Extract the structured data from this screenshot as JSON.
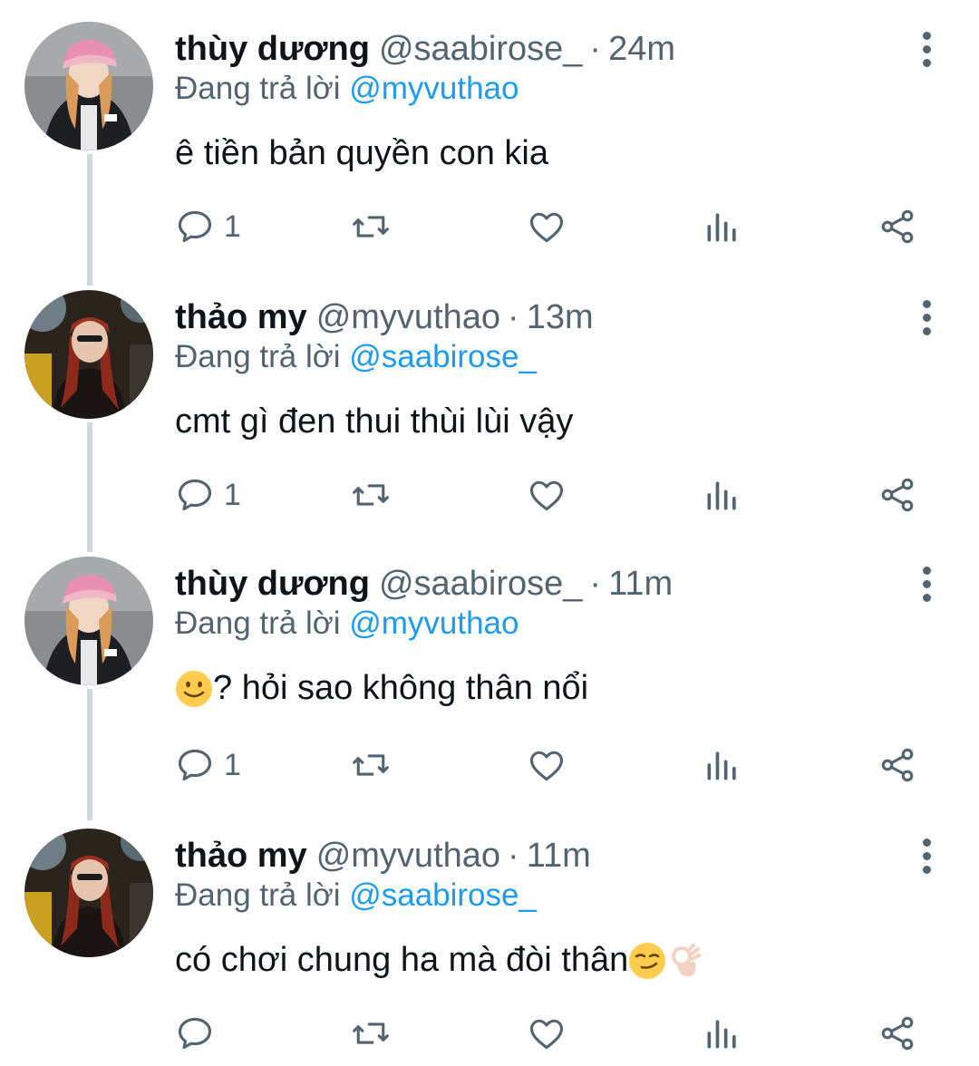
{
  "colors": {
    "name": "#0f1419",
    "muted": "#536471",
    "link": "#1d9bf0",
    "thread_line": "#cfd9de"
  },
  "tweets": [
    {
      "name": "thùy dương",
      "handle": "@saabirose_",
      "separator": "·",
      "time": "24m",
      "replying_prefix": "Đang trả lời",
      "replying_to": "@myvuthao",
      "text": "ê tiền bản quyền con kia",
      "reply_count": "1",
      "avatar_icon": "avatar-photo-woman-pink-cap"
    },
    {
      "name": "thảo my",
      "handle": "@myvuthao",
      "separator": "·",
      "time": "13m",
      "replying_prefix": "Đang trả lời",
      "replying_to": "@saabirose_",
      "text": "cmt gì đen thui thùi lùi vậy",
      "reply_count": "1",
      "avatar_icon": "avatar-photo-woman-red-hair"
    },
    {
      "name": "thùy dương",
      "handle": "@saabirose_",
      "separator": "·",
      "time": "11m",
      "replying_prefix": "Đang trả lời",
      "replying_to": "@myvuthao",
      "text_emoji": "slightly-smiling-face-emoji",
      "text": "? hỏi sao không thân nổi",
      "reply_count": "1",
      "avatar_icon": "avatar-photo-woman-pink-cap"
    },
    {
      "name": "thảo my",
      "handle": "@myvuthao",
      "separator": "·",
      "time": "11m",
      "replying_prefix": "Đang trả lời",
      "replying_to": "@saabirose_",
      "text": "có chơi chung ha mà đòi thân",
      "text_emoji_after": [
        "smirking-face-emoji",
        "ok-hand-emoji"
      ],
      "reply_count": "",
      "avatar_icon": "avatar-photo-woman-red-hair"
    }
  ],
  "action_icons": [
    "reply-icon",
    "retweet-icon",
    "like-icon",
    "views-icon",
    "share-icon"
  ]
}
